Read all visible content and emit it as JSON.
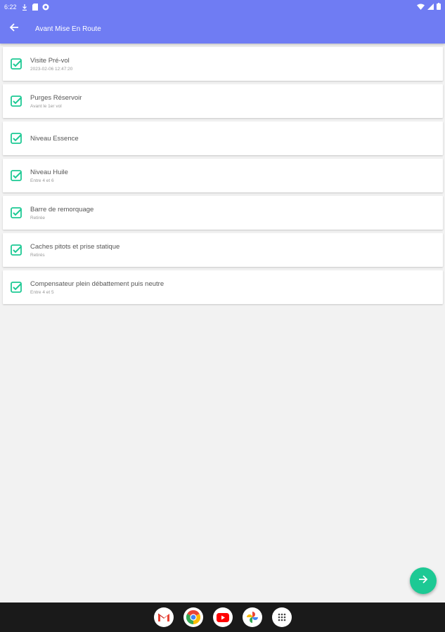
{
  "status_bar": {
    "time": "6:22",
    "left_icons": [
      "download-icon",
      "sim-icon",
      "settings-dot-icon"
    ],
    "right_icons": [
      "wifi-icon",
      "signal-icon",
      "battery-icon"
    ]
  },
  "toolbar": {
    "title": "Avant Mise En Route",
    "color": "#6f7cf3"
  },
  "items": [
    {
      "label": "Visite Pré-vol",
      "sub": "2023-02-06 12:47:20",
      "checked": true
    },
    {
      "label": "Purges Réservoir",
      "sub": "Avant le 1er vol",
      "checked": true
    },
    {
      "label": "Niveau Essence",
      "sub": "",
      "checked": true
    },
    {
      "label": "Niveau Huile",
      "sub": "Entre 4 et 6",
      "checked": true
    },
    {
      "label": "Barre de remorquage",
      "sub": "Retirée",
      "checked": true
    },
    {
      "label": "Caches pitots et prise statique",
      "sub": "Retirés",
      "checked": true
    },
    {
      "label": "Compensateur plein débattement puis neutre",
      "sub": "Entre 4 et 5",
      "checked": true
    }
  ],
  "accent_color": "#1dc994",
  "fab_icon": "arrow-right-icon",
  "dock_apps": [
    "gmail-icon",
    "chrome-icon",
    "youtube-icon",
    "photos-icon",
    "app-drawer-icon"
  ]
}
